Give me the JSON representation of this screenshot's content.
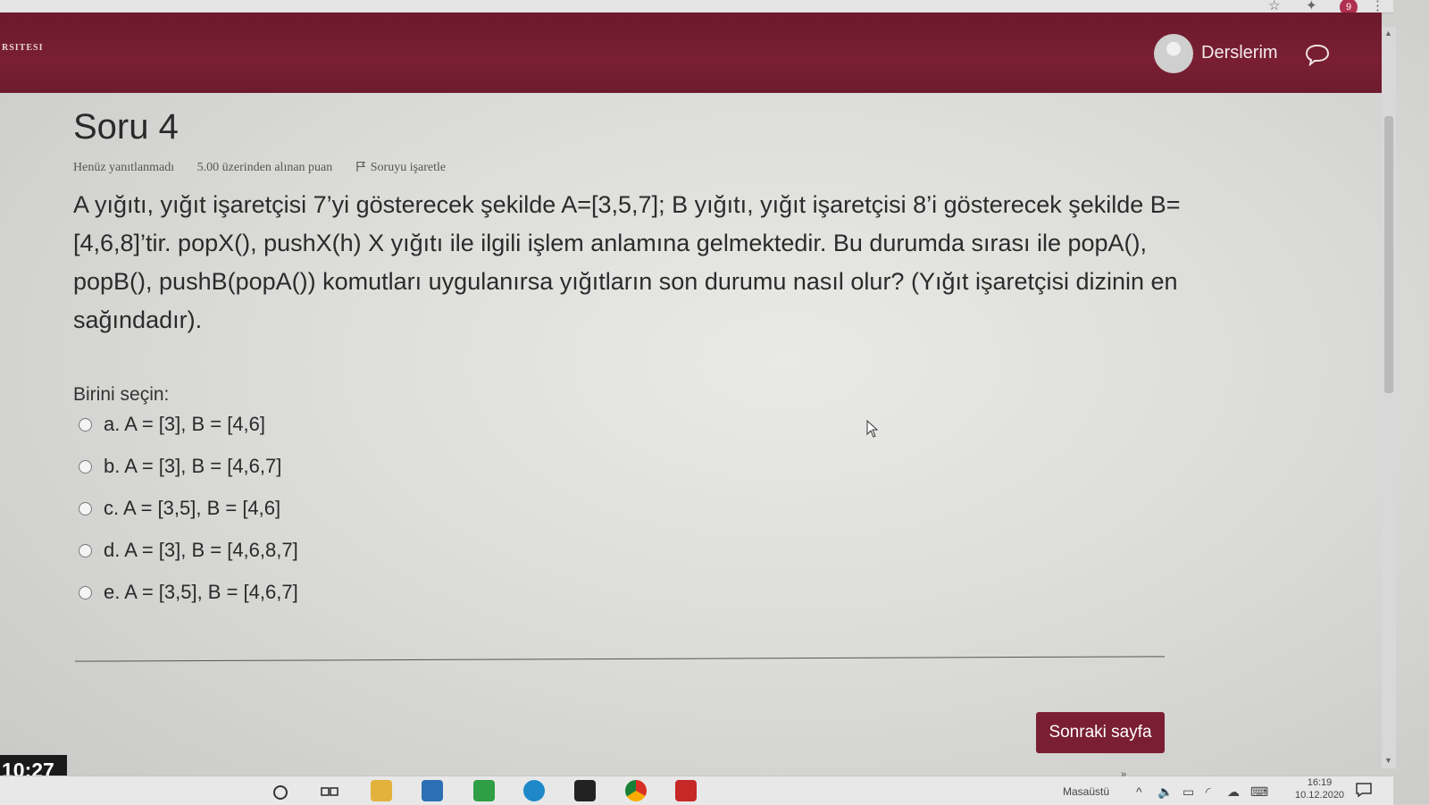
{
  "header": {
    "brand_fragment": "RSITESI",
    "courses_label": "Derslerim",
    "notification_count": "9"
  },
  "question": {
    "title": "Soru 4",
    "status": "Henüz yanıtlanmadı",
    "points": "5.00 üzerinden alınan puan",
    "flag_label": "Soruyu işaretle",
    "text": "A yığıtı, yığıt işaretçisi 7’yi gösterecek şekilde A=[3,5,7]; B yığıtı, yığıt işaretçisi 8’i gösterecek şekilde B=[4,6,8]’tir. popX(), pushX(h) X yığıtı ile ilgili işlem anlamına gelmektedir. Bu durumda sırası ile popA(), popB(), pushB(popA()) komutları uygulanırsa yığıtların son durumu nasıl olur? (Yığıt işaretçisi dizinin en sağındadır).",
    "prompt": "Birini seçin:",
    "options": [
      {
        "label": "a. A = [3], B = [4,6]"
      },
      {
        "label": "b. A = [3], B = [4,6,7]"
      },
      {
        "label": "c. A = [3,5], B = [4,6]"
      },
      {
        "label": "d. A = [3], B = [4,6,8,7]"
      },
      {
        "label": "e. A = [3,5], B = [4,6,7]"
      }
    ],
    "next_button": "Sonraki sayfa"
  },
  "overlay": {
    "clock": "10:27"
  },
  "taskbar": {
    "desktop_label": "Masaüstü",
    "time": "16:19",
    "date": "10.12.2020"
  },
  "colors": {
    "brand": "#7a1f33",
    "background": "#e4e4e2"
  }
}
